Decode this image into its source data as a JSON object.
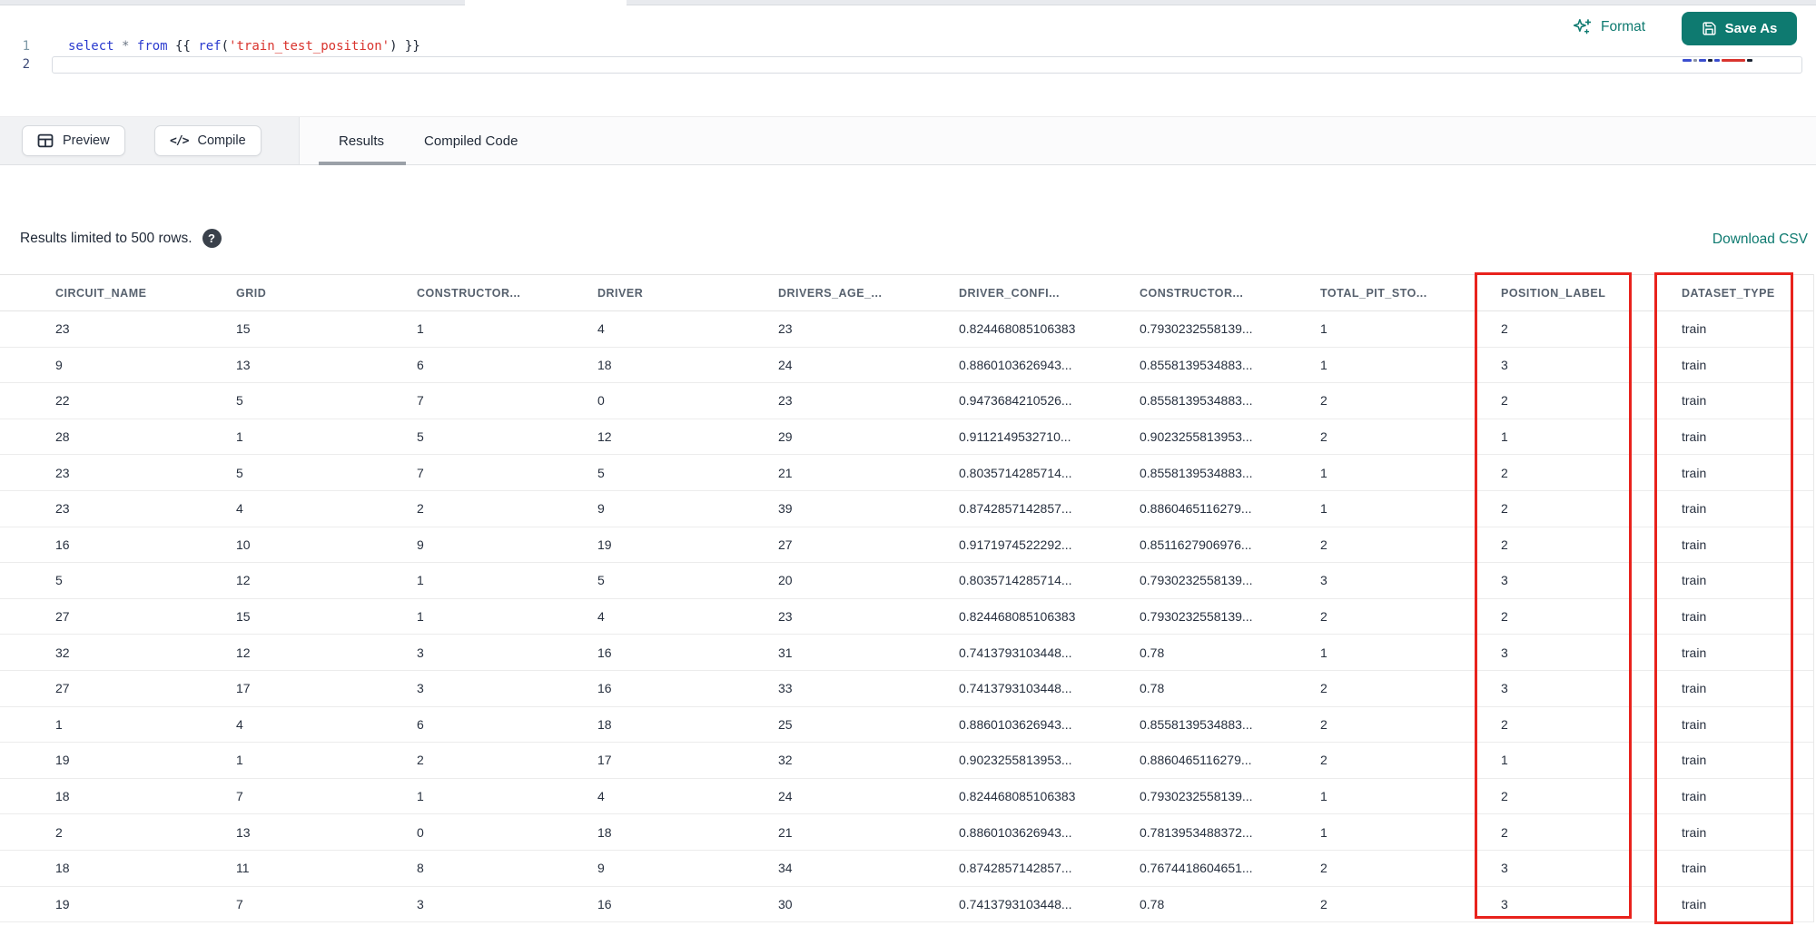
{
  "editor": {
    "line_numbers": [
      "1",
      "2"
    ],
    "code_text": "select * from {{ ref('train_test_position') }}",
    "tokens": [
      {
        "text": "select",
        "type": "keyword"
      },
      {
        "text": " ",
        "type": "plain"
      },
      {
        "text": "*",
        "type": "operator"
      },
      {
        "text": " ",
        "type": "plain"
      },
      {
        "text": "from",
        "type": "keyword"
      },
      {
        "text": " {{ ",
        "type": "plain"
      },
      {
        "text": "ref",
        "type": "keyword"
      },
      {
        "text": "(",
        "type": "plain"
      },
      {
        "text": "'train_test_position'",
        "type": "string"
      },
      {
        "text": ") }}",
        "type": "plain"
      }
    ],
    "actions": {
      "format_label": "Format",
      "save_as_label": "Save As"
    }
  },
  "toolbar": {
    "preview_label": "Preview",
    "compile_label": "Compile",
    "compile_glyph": "</>",
    "tabs": [
      {
        "label": "Results",
        "active": true
      },
      {
        "label": "Compiled Code",
        "active": false
      }
    ]
  },
  "results_bar": {
    "info_text": "Results limited to 500 rows.",
    "help_glyph": "?",
    "download_label": "Download CSV"
  },
  "table": {
    "columns": [
      "CIRCUIT_NAME",
      "GRID",
      "CONSTRUCTOR...",
      "DRIVER",
      "DRIVERS_AGE_...",
      "DRIVER_CONFI...",
      "CONSTRUCTOR...",
      "TOTAL_PIT_STO...",
      "POSITION_LABEL",
      "DATASET_TYPE"
    ],
    "rows": [
      [
        "23",
        "15",
        "1",
        "4",
        "23",
        "0.824468085106383",
        "0.7930232558139...",
        "1",
        "2",
        "train"
      ],
      [
        "9",
        "13",
        "6",
        "18",
        "24",
        "0.8860103626943...",
        "0.8558139534883...",
        "1",
        "3",
        "train"
      ],
      [
        "22",
        "5",
        "7",
        "0",
        "23",
        "0.9473684210526...",
        "0.8558139534883...",
        "2",
        "2",
        "train"
      ],
      [
        "28",
        "1",
        "5",
        "12",
        "29",
        "0.9112149532710...",
        "0.9023255813953...",
        "2",
        "1",
        "train"
      ],
      [
        "23",
        "5",
        "7",
        "5",
        "21",
        "0.8035714285714...",
        "0.8558139534883...",
        "1",
        "2",
        "train"
      ],
      [
        "23",
        "4",
        "2",
        "9",
        "39",
        "0.8742857142857...",
        "0.8860465116279...",
        "1",
        "2",
        "train"
      ],
      [
        "16",
        "10",
        "9",
        "19",
        "27",
        "0.9171974522292...",
        "0.8511627906976...",
        "2",
        "2",
        "train"
      ],
      [
        "5",
        "12",
        "1",
        "5",
        "20",
        "0.8035714285714...",
        "0.7930232558139...",
        "3",
        "3",
        "train"
      ],
      [
        "27",
        "15",
        "1",
        "4",
        "23",
        "0.824468085106383",
        "0.7930232558139...",
        "2",
        "2",
        "train"
      ],
      [
        "32",
        "12",
        "3",
        "16",
        "31",
        "0.7413793103448...",
        "0.78",
        "1",
        "3",
        "train"
      ],
      [
        "27",
        "17",
        "3",
        "16",
        "33",
        "0.7413793103448...",
        "0.78",
        "2",
        "3",
        "train"
      ],
      [
        "1",
        "4",
        "6",
        "18",
        "25",
        "0.8860103626943...",
        "0.8558139534883...",
        "2",
        "2",
        "train"
      ],
      [
        "19",
        "1",
        "2",
        "17",
        "32",
        "0.9023255813953...",
        "0.8860465116279...",
        "2",
        "1",
        "train"
      ],
      [
        "18",
        "7",
        "1",
        "4",
        "24",
        "0.824468085106383",
        "0.7930232558139...",
        "1",
        "2",
        "train"
      ],
      [
        "2",
        "13",
        "0",
        "18",
        "21",
        "0.8860103626943...",
        "0.7813953488372...",
        "1",
        "2",
        "train"
      ],
      [
        "18",
        "11",
        "8",
        "9",
        "34",
        "0.8742857142857...",
        "0.7674418604651...",
        "2",
        "3",
        "train"
      ],
      [
        "19",
        "7",
        "3",
        "16",
        "30",
        "0.7413793103448...",
        "0.78",
        "2",
        "3",
        "train"
      ]
    ],
    "annotations": [
      {
        "column": "POSITION_LABEL",
        "style": "red-box"
      },
      {
        "column": "DATASET_TYPE",
        "style": "red-box"
      }
    ]
  },
  "colors": {
    "accent_teal": "#0E7A70",
    "annotation_red": "#E8231D",
    "keyword_blue": "#2B3BCF",
    "string_red": "#D9342E",
    "header_text": "#57616E",
    "cell_text": "#27303F"
  }
}
